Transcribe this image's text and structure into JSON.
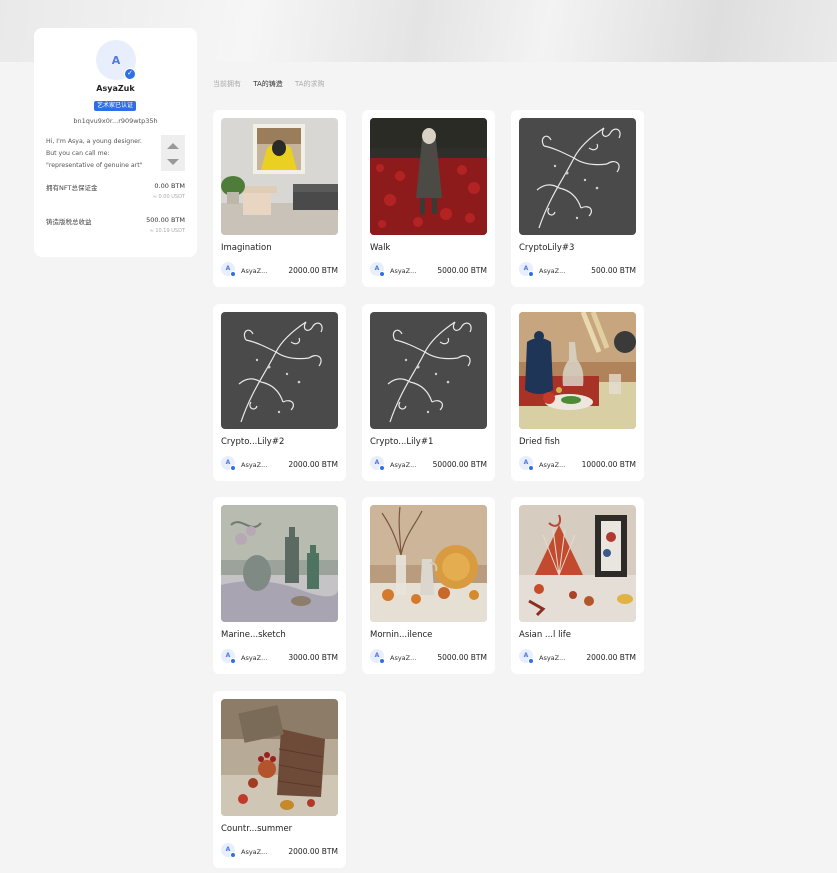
{
  "profile": {
    "avatar_letter": "A",
    "name": "AsyaZuk",
    "badge": "艺术家已认证",
    "address": "bn1qvu9x0r...r909wtp35h",
    "bio_lines": [
      "Hi, I'm Asya, a young designer.",
      "But you can call me:",
      "\"representative of genuine art\""
    ],
    "stats": [
      {
        "label": "拥有NFT总保证金",
        "value": "0.00 BTM",
        "sub": "≈ 0.00 USDT"
      },
      {
        "label": "铸造版税总收益",
        "value": "500.00 BTM",
        "sub": "≈ 10.19 USDT"
      }
    ]
  },
  "tabs": [
    {
      "label": "当前拥有",
      "active": false
    },
    {
      "label": "TA的铸造",
      "active": true
    },
    {
      "label": "TA的求购",
      "active": false
    }
  ],
  "cards": [
    {
      "title": "Imagination",
      "author": "AsyaZ...",
      "price": "2000.00 BTM",
      "art": "interior"
    },
    {
      "title": "Walk",
      "author": "AsyaZ...",
      "price": "5000.00 BTM",
      "art": "walk"
    },
    {
      "title": "CryptoLily#3",
      "author": "AsyaZ...",
      "price": "500.00 BTM",
      "art": "lily"
    },
    {
      "title": "Crypto...Lily#2",
      "author": "AsyaZ...",
      "price": "2000.00 BTM",
      "art": "lily"
    },
    {
      "title": "Crypto...Lily#1",
      "author": "AsyaZ...",
      "price": "50000.00 BTM",
      "art": "lily"
    },
    {
      "title": "Dried fish",
      "author": "AsyaZ...",
      "price": "10000.00 BTM",
      "art": "still"
    },
    {
      "title": "Marine...sketch",
      "author": "AsyaZ...",
      "price": "3000.00 BTM",
      "art": "marine"
    },
    {
      "title": "Mornin...ilence",
      "author": "AsyaZ...",
      "price": "5000.00 BTM",
      "art": "morning"
    },
    {
      "title": "Asian ...l life",
      "author": "AsyaZ...",
      "price": "2000.00 BTM",
      "art": "asian"
    },
    {
      "title": "Countr...summer",
      "author": "AsyaZ...",
      "price": "2000.00 BTM",
      "art": "country"
    }
  ]
}
